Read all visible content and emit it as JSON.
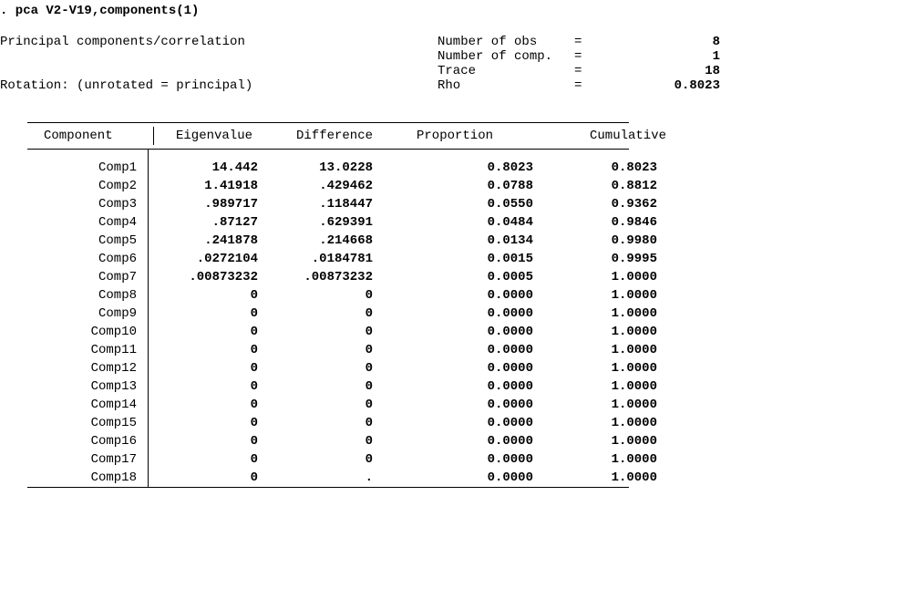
{
  "command": ". pca V2-V19,components(1)",
  "header": {
    "title": "Principal components/correlation",
    "rotation": "   Rotation: (unrotated = principal)",
    "stats": [
      {
        "label": "Number of obs",
        "eq": "=",
        "value": "8",
        "bold": true
      },
      {
        "label": "Number of comp.",
        "eq": "=",
        "value": "1",
        "bold": true
      },
      {
        "label": "Trace",
        "eq": "=",
        "value": "18",
        "bold": true
      },
      {
        "label": "Rho",
        "eq": "=",
        "value": "0.8023",
        "bold": true
      }
    ]
  },
  "table": {
    "headers": {
      "component": "Component",
      "eigenvalue": "Eigenvalue",
      "difference": "Difference",
      "proportion": "Proportion",
      "cumulative": "Cumulative"
    },
    "rows": [
      {
        "comp": "Comp1",
        "eig": "14.442",
        "diff": "13.0228",
        "prop": "0.8023",
        "cum": "0.8023"
      },
      {
        "comp": "Comp2",
        "eig": "1.41918",
        "diff": ".429462",
        "prop": "0.0788",
        "cum": "0.8812"
      },
      {
        "comp": "Comp3",
        "eig": ".989717",
        "diff": ".118447",
        "prop": "0.0550",
        "cum": "0.9362"
      },
      {
        "comp": "Comp4",
        "eig": ".87127",
        "diff": ".629391",
        "prop": "0.0484",
        "cum": "0.9846"
      },
      {
        "comp": "Comp5",
        "eig": ".241878",
        "diff": ".214668",
        "prop": "0.0134",
        "cum": "0.9980"
      },
      {
        "comp": "Comp6",
        "eig": ".0272104",
        "diff": ".0184781",
        "prop": "0.0015",
        "cum": "0.9995"
      },
      {
        "comp": "Comp7",
        "eig": ".00873232",
        "diff": ".00873232",
        "prop": "0.0005",
        "cum": "1.0000"
      },
      {
        "comp": "Comp8",
        "eig": "0",
        "diff": "0",
        "prop": "0.0000",
        "cum": "1.0000"
      },
      {
        "comp": "Comp9",
        "eig": "0",
        "diff": "0",
        "prop": "0.0000",
        "cum": "1.0000"
      },
      {
        "comp": "Comp10",
        "eig": "0",
        "diff": "0",
        "prop": "0.0000",
        "cum": "1.0000"
      },
      {
        "comp": "Comp11",
        "eig": "0",
        "diff": "0",
        "prop": "0.0000",
        "cum": "1.0000"
      },
      {
        "comp": "Comp12",
        "eig": "0",
        "diff": "0",
        "prop": "0.0000",
        "cum": "1.0000"
      },
      {
        "comp": "Comp13",
        "eig": "0",
        "diff": "0",
        "prop": "0.0000",
        "cum": "1.0000"
      },
      {
        "comp": "Comp14",
        "eig": "0",
        "diff": "0",
        "prop": "0.0000",
        "cum": "1.0000"
      },
      {
        "comp": "Comp15",
        "eig": "0",
        "diff": "0",
        "prop": "0.0000",
        "cum": "1.0000"
      },
      {
        "comp": "Comp16",
        "eig": "0",
        "diff": "0",
        "prop": "0.0000",
        "cum": "1.0000"
      },
      {
        "comp": "Comp17",
        "eig": "0",
        "diff": "0",
        "prop": "0.0000",
        "cum": "1.0000"
      },
      {
        "comp": "Comp18",
        "eig": "0",
        "diff": ".",
        "prop": "0.0000",
        "cum": "1.0000"
      }
    ]
  }
}
